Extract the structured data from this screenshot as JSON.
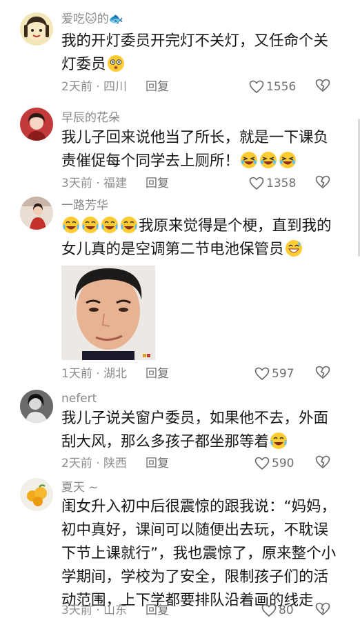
{
  "comments": [
    {
      "username": "爱吃🐱的🐟",
      "text_before": "我的开灯委员开完灯不关灯，又任命个关灯委员",
      "emoji": [
        "dizzy-face"
      ],
      "time": "2天前 · 四川",
      "reply": "回复",
      "likes": "1556"
    },
    {
      "username": "早辰的花朵",
      "text_before": "我儿子回来说他当了所长，就是一下课负责催促每个同学去上厕所！",
      "emoji": [
        "laughing-face",
        "laughing-face",
        "laughing-face"
      ],
      "time": "3天前 · 福建",
      "reply": "回复",
      "likes": "1358"
    },
    {
      "username": "一路芳华",
      "emoji_lead": [
        "tears-of-joy",
        "tears-of-joy",
        "tears-of-joy",
        "tears-of-joy"
      ],
      "text_before": "我原来觉得是个梗，直到我的女儿真的是空调第二节电池保管员",
      "emoji": [
        "grinning-sweat"
      ],
      "time": "1天前 · 湖北",
      "reply": "回复",
      "likes": "597",
      "has_image": true
    },
    {
      "username": "nefert",
      "text_before": "我儿子说关窗户委员，如果他不去，外面刮大风，那么多孩子都坐那等着",
      "emoji": [
        "tears-of-joy"
      ],
      "time": "2天前 · 陕西",
      "reply": "回复",
      "likes": "590"
    },
    {
      "username": "夏天 ~",
      "text_before": "闺女升入初中后很震惊的跟我说：“妈妈，初中真好，课间可以随便出去玩，不耽误下节上课就行”，我也震惊了，原来整个小学期间，学校为了安全，限制孩子们的活动范围，上下学都要排队沿着画的线走",
      "emoji": [],
      "time": "3天前 · 山东",
      "reply": "回复",
      "likes": "80"
    }
  ],
  "colors": {
    "text": "#161616",
    "meta": "#8e8e8e",
    "background": "#ffffff"
  }
}
